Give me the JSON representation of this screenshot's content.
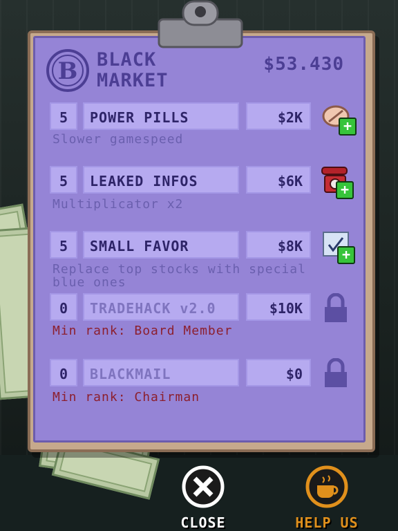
{
  "header": {
    "title_line1": "BLACK",
    "title_line2": "MARKET",
    "money": "$53.430",
    "logo_letter": "B"
  },
  "items": [
    {
      "qty": "5",
      "name": "POWER PILLS",
      "price": "$2K",
      "description": "Slower gamespeed",
      "icon": "pill-icon",
      "locked": false
    },
    {
      "qty": "5",
      "name": "LEAKED INFOS",
      "price": "$6K",
      "description": "Multiplicator x2",
      "icon": "telephone-icon",
      "locked": false
    },
    {
      "qty": "5",
      "name": "SMALL FAVOR",
      "price": "$8K",
      "description": "Replace top stocks with special blue ones",
      "icon": "note-icon",
      "locked": false
    },
    {
      "qty": "0",
      "name": "TRADEHACK v2.0",
      "price": "$10K",
      "requirement": "Min rank: Board Member",
      "icon": "lock-icon",
      "locked": true
    },
    {
      "qty": "0",
      "name": "BLACKMAIL",
      "price": "$0",
      "requirement": "Min rank: Chairman",
      "icon": "lock-icon",
      "locked": true
    }
  ],
  "buttons": {
    "close_label": "CLOSE",
    "help_label": "HELP US"
  },
  "colors": {
    "paper": "#9584d6",
    "accent_text": "#4c3e94",
    "help_orange": "#e0901c"
  }
}
